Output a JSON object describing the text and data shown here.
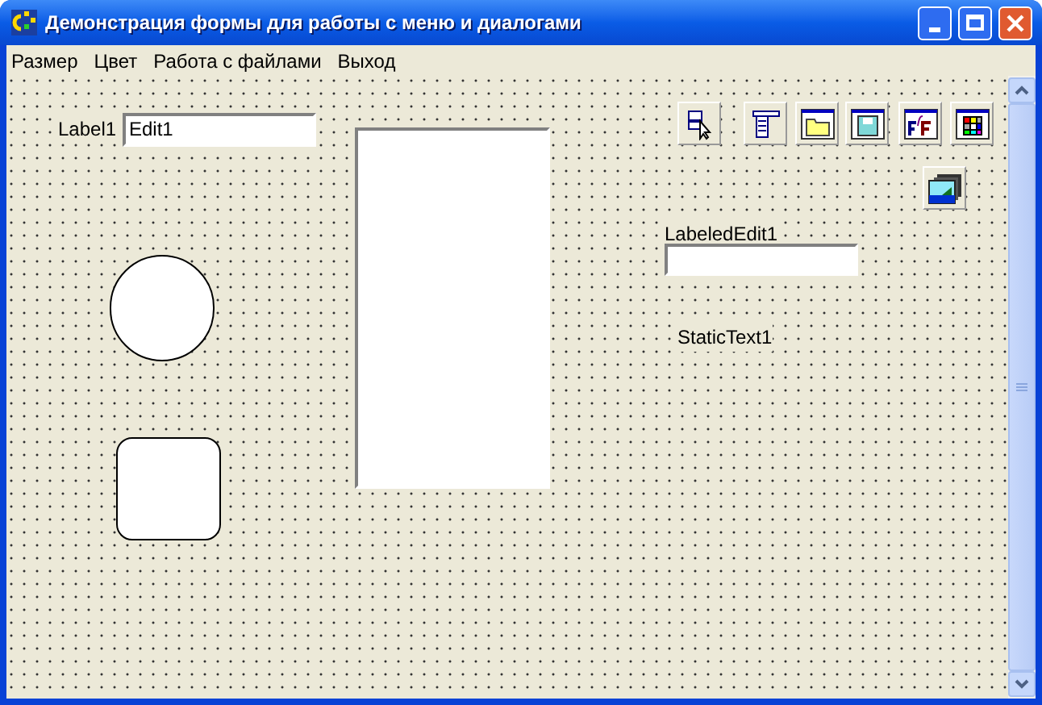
{
  "window": {
    "title": "Демонстрация формы для работы с меню и диалогами"
  },
  "menu": [
    "Размер",
    "Цвет",
    "Работа с файлами",
    "Выход"
  ],
  "form": {
    "label": "Label1",
    "edit": "Edit1",
    "labeled_edit_label": "LabeledEdit1",
    "static_text": "StaticText1"
  }
}
